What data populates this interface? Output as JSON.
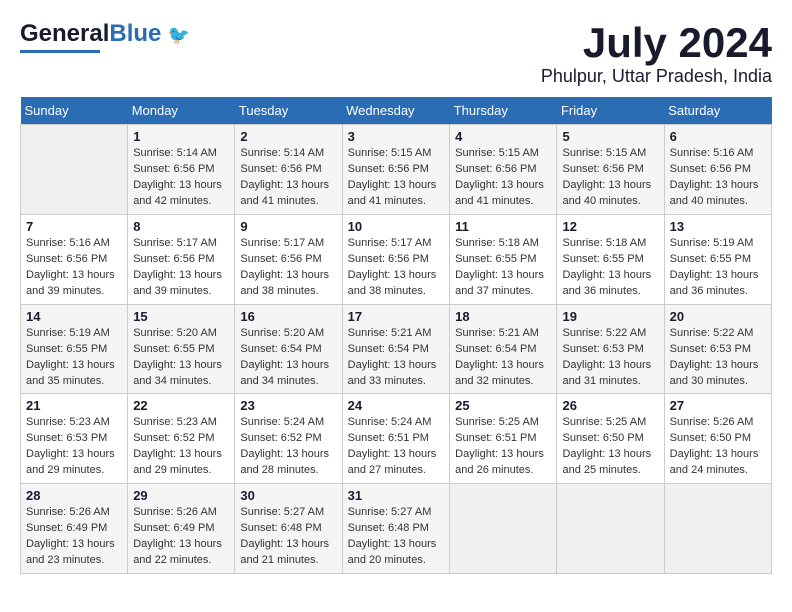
{
  "header": {
    "logo_general": "General",
    "logo_blue": "Blue",
    "month": "July 2024",
    "location": "Phulpur, Uttar Pradesh, India"
  },
  "weekdays": [
    "Sunday",
    "Monday",
    "Tuesday",
    "Wednesday",
    "Thursday",
    "Friday",
    "Saturday"
  ],
  "weeks": [
    [
      {
        "day": "",
        "empty": true
      },
      {
        "day": "1",
        "sunrise": "Sunrise: 5:14 AM",
        "sunset": "Sunset: 6:56 PM",
        "daylight": "Daylight: 13 hours and 42 minutes."
      },
      {
        "day": "2",
        "sunrise": "Sunrise: 5:14 AM",
        "sunset": "Sunset: 6:56 PM",
        "daylight": "Daylight: 13 hours and 41 minutes."
      },
      {
        "day": "3",
        "sunrise": "Sunrise: 5:15 AM",
        "sunset": "Sunset: 6:56 PM",
        "daylight": "Daylight: 13 hours and 41 minutes."
      },
      {
        "day": "4",
        "sunrise": "Sunrise: 5:15 AM",
        "sunset": "Sunset: 6:56 PM",
        "daylight": "Daylight: 13 hours and 41 minutes."
      },
      {
        "day": "5",
        "sunrise": "Sunrise: 5:15 AM",
        "sunset": "Sunset: 6:56 PM",
        "daylight": "Daylight: 13 hours and 40 minutes."
      },
      {
        "day": "6",
        "sunrise": "Sunrise: 5:16 AM",
        "sunset": "Sunset: 6:56 PM",
        "daylight": "Daylight: 13 hours and 40 minutes."
      }
    ],
    [
      {
        "day": "7",
        "sunrise": "Sunrise: 5:16 AM",
        "sunset": "Sunset: 6:56 PM",
        "daylight": "Daylight: 13 hours and 39 minutes."
      },
      {
        "day": "8",
        "sunrise": "Sunrise: 5:17 AM",
        "sunset": "Sunset: 6:56 PM",
        "daylight": "Daylight: 13 hours and 39 minutes."
      },
      {
        "day": "9",
        "sunrise": "Sunrise: 5:17 AM",
        "sunset": "Sunset: 6:56 PM",
        "daylight": "Daylight: 13 hours and 38 minutes."
      },
      {
        "day": "10",
        "sunrise": "Sunrise: 5:17 AM",
        "sunset": "Sunset: 6:56 PM",
        "daylight": "Daylight: 13 hours and 38 minutes."
      },
      {
        "day": "11",
        "sunrise": "Sunrise: 5:18 AM",
        "sunset": "Sunset: 6:55 PM",
        "daylight": "Daylight: 13 hours and 37 minutes."
      },
      {
        "day": "12",
        "sunrise": "Sunrise: 5:18 AM",
        "sunset": "Sunset: 6:55 PM",
        "daylight": "Daylight: 13 hours and 36 minutes."
      },
      {
        "day": "13",
        "sunrise": "Sunrise: 5:19 AM",
        "sunset": "Sunset: 6:55 PM",
        "daylight": "Daylight: 13 hours and 36 minutes."
      }
    ],
    [
      {
        "day": "14",
        "sunrise": "Sunrise: 5:19 AM",
        "sunset": "Sunset: 6:55 PM",
        "daylight": "Daylight: 13 hours and 35 minutes."
      },
      {
        "day": "15",
        "sunrise": "Sunrise: 5:20 AM",
        "sunset": "Sunset: 6:55 PM",
        "daylight": "Daylight: 13 hours and 34 minutes."
      },
      {
        "day": "16",
        "sunrise": "Sunrise: 5:20 AM",
        "sunset": "Sunset: 6:54 PM",
        "daylight": "Daylight: 13 hours and 34 minutes."
      },
      {
        "day": "17",
        "sunrise": "Sunrise: 5:21 AM",
        "sunset": "Sunset: 6:54 PM",
        "daylight": "Daylight: 13 hours and 33 minutes."
      },
      {
        "day": "18",
        "sunrise": "Sunrise: 5:21 AM",
        "sunset": "Sunset: 6:54 PM",
        "daylight": "Daylight: 13 hours and 32 minutes."
      },
      {
        "day": "19",
        "sunrise": "Sunrise: 5:22 AM",
        "sunset": "Sunset: 6:53 PM",
        "daylight": "Daylight: 13 hours and 31 minutes."
      },
      {
        "day": "20",
        "sunrise": "Sunrise: 5:22 AM",
        "sunset": "Sunset: 6:53 PM",
        "daylight": "Daylight: 13 hours and 30 minutes."
      }
    ],
    [
      {
        "day": "21",
        "sunrise": "Sunrise: 5:23 AM",
        "sunset": "Sunset: 6:53 PM",
        "daylight": "Daylight: 13 hours and 29 minutes."
      },
      {
        "day": "22",
        "sunrise": "Sunrise: 5:23 AM",
        "sunset": "Sunset: 6:52 PM",
        "daylight": "Daylight: 13 hours and 29 minutes."
      },
      {
        "day": "23",
        "sunrise": "Sunrise: 5:24 AM",
        "sunset": "Sunset: 6:52 PM",
        "daylight": "Daylight: 13 hours and 28 minutes."
      },
      {
        "day": "24",
        "sunrise": "Sunrise: 5:24 AM",
        "sunset": "Sunset: 6:51 PM",
        "daylight": "Daylight: 13 hours and 27 minutes."
      },
      {
        "day": "25",
        "sunrise": "Sunrise: 5:25 AM",
        "sunset": "Sunset: 6:51 PM",
        "daylight": "Daylight: 13 hours and 26 minutes."
      },
      {
        "day": "26",
        "sunrise": "Sunrise: 5:25 AM",
        "sunset": "Sunset: 6:50 PM",
        "daylight": "Daylight: 13 hours and 25 minutes."
      },
      {
        "day": "27",
        "sunrise": "Sunrise: 5:26 AM",
        "sunset": "Sunset: 6:50 PM",
        "daylight": "Daylight: 13 hours and 24 minutes."
      }
    ],
    [
      {
        "day": "28",
        "sunrise": "Sunrise: 5:26 AM",
        "sunset": "Sunset: 6:49 PM",
        "daylight": "Daylight: 13 hours and 23 minutes."
      },
      {
        "day": "29",
        "sunrise": "Sunrise: 5:26 AM",
        "sunset": "Sunset: 6:49 PM",
        "daylight": "Daylight: 13 hours and 22 minutes."
      },
      {
        "day": "30",
        "sunrise": "Sunrise: 5:27 AM",
        "sunset": "Sunset: 6:48 PM",
        "daylight": "Daylight: 13 hours and 21 minutes."
      },
      {
        "day": "31",
        "sunrise": "Sunrise: 5:27 AM",
        "sunset": "Sunset: 6:48 PM",
        "daylight": "Daylight: 13 hours and 20 minutes."
      },
      {
        "day": "",
        "empty": true
      },
      {
        "day": "",
        "empty": true
      },
      {
        "day": "",
        "empty": true
      }
    ]
  ]
}
